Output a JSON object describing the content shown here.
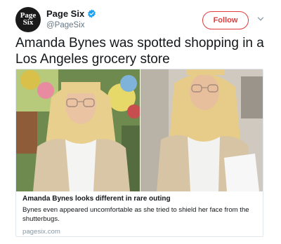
{
  "author": {
    "avatar_line1": "Page",
    "avatar_line2": "Six",
    "display_name": "Page Six",
    "handle": "@PageSix"
  },
  "actions": {
    "follow_label": "Follow"
  },
  "tweet": {
    "text": "Amanda Bynes was spotted shopping in a Los Angeles grocery store"
  },
  "card": {
    "title": "Amanda Bynes looks different in rare outing",
    "description": "Bynes even appeared uncomfortable as she tried to shield her face from the shutterbugs.",
    "domain": "pagesix.com"
  },
  "colors": {
    "follow_accent": "#e23a3a",
    "verified_blue": "#1da1f2"
  }
}
